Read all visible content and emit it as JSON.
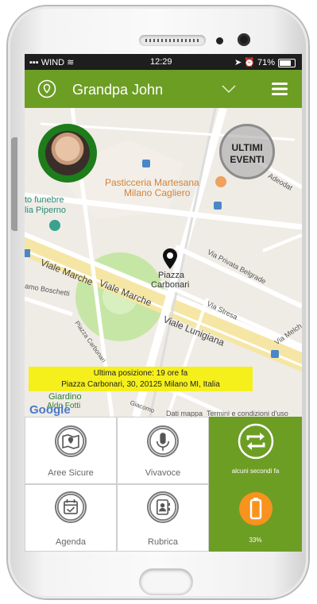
{
  "status": {
    "carrier": "WIND",
    "time": "12:29",
    "battery": "71%"
  },
  "header": {
    "name": "Grandpa John"
  },
  "map": {
    "labels": {
      "pasticceria": "Pasticceria Martesana",
      "cagliero": "Milano Cagliero",
      "funebre": "to funebre",
      "piperno": "lia Piperno",
      "piazza": "Piazza",
      "carbonari": "Carbonari",
      "marche1": "Viale Marche",
      "marche2": "Viale Marche",
      "lunigiana": "Viale Lunigiana",
      "belgrade": "Via Privata Belgrade",
      "stresa": "Via Stresa",
      "boschetti": "amo Boschetti",
      "adeodat": "Adeodat",
      "giardino": "Giardino",
      "melchi": "Via Melch",
      "giacomo": "Giacomo",
      "carbonari_small": "Piazza Carbonari",
      "fotti": "Aldo Fotti"
    },
    "ultimi": {
      "line1": "ULTIMI",
      "line2": "EVENTI"
    },
    "last_position": {
      "line1": "Ultima posizione: 19 ore fa",
      "line2": "Piazza Carbonari, 30, 20125 Milano MI, Italia"
    },
    "google": "Google",
    "dati": "Dati mappa",
    "termini": "Termini e condizioni d'uso"
  },
  "grid": {
    "aree": "Aree Sicure",
    "vivavoce": "Vivavoce",
    "refresh": "alcuni secondi fa",
    "agenda": "Agenda",
    "rubrica": "Rubrica",
    "battery": "33%"
  },
  "colors": {
    "accent": "#6d9e24",
    "battery": "#f7931e",
    "banner": "#f5ef1c"
  }
}
